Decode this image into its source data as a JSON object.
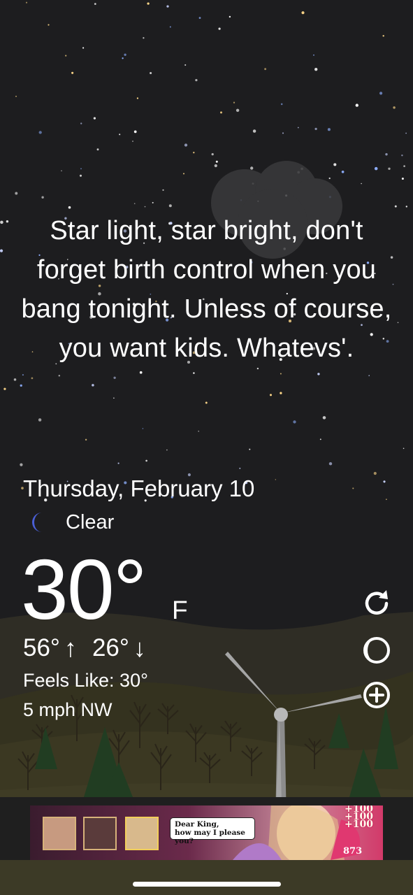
{
  "quote": "Star light, star bright, don't forget birth control when you bang tonight. Unless of course, you want kids. Whatevs'.",
  "weather": {
    "date": "Thursday, February 10",
    "condition": "Clear",
    "temperature": "30°",
    "unit": "F",
    "high": "56°",
    "high_arrow": "↑",
    "low": "26°",
    "low_arrow": "↓",
    "feels_like": "Feels Like: 30°",
    "wind": "5 mph NW"
  },
  "icons": {
    "condition": "crescent-moon-icon",
    "refresh": "refresh-icon",
    "theme": "moon-toggle-icon",
    "add": "add-circle-icon"
  },
  "ad": {
    "bubble_line1": "Dear King,",
    "bubble_line2": "how may I please you?",
    "plus_values": [
      "+100",
      "+100",
      "+100"
    ],
    "count": "873"
  },
  "colors": {
    "sky": "#1d1d1f",
    "moon": "#4a5fd6",
    "ad_bg": "#8b2c46"
  }
}
